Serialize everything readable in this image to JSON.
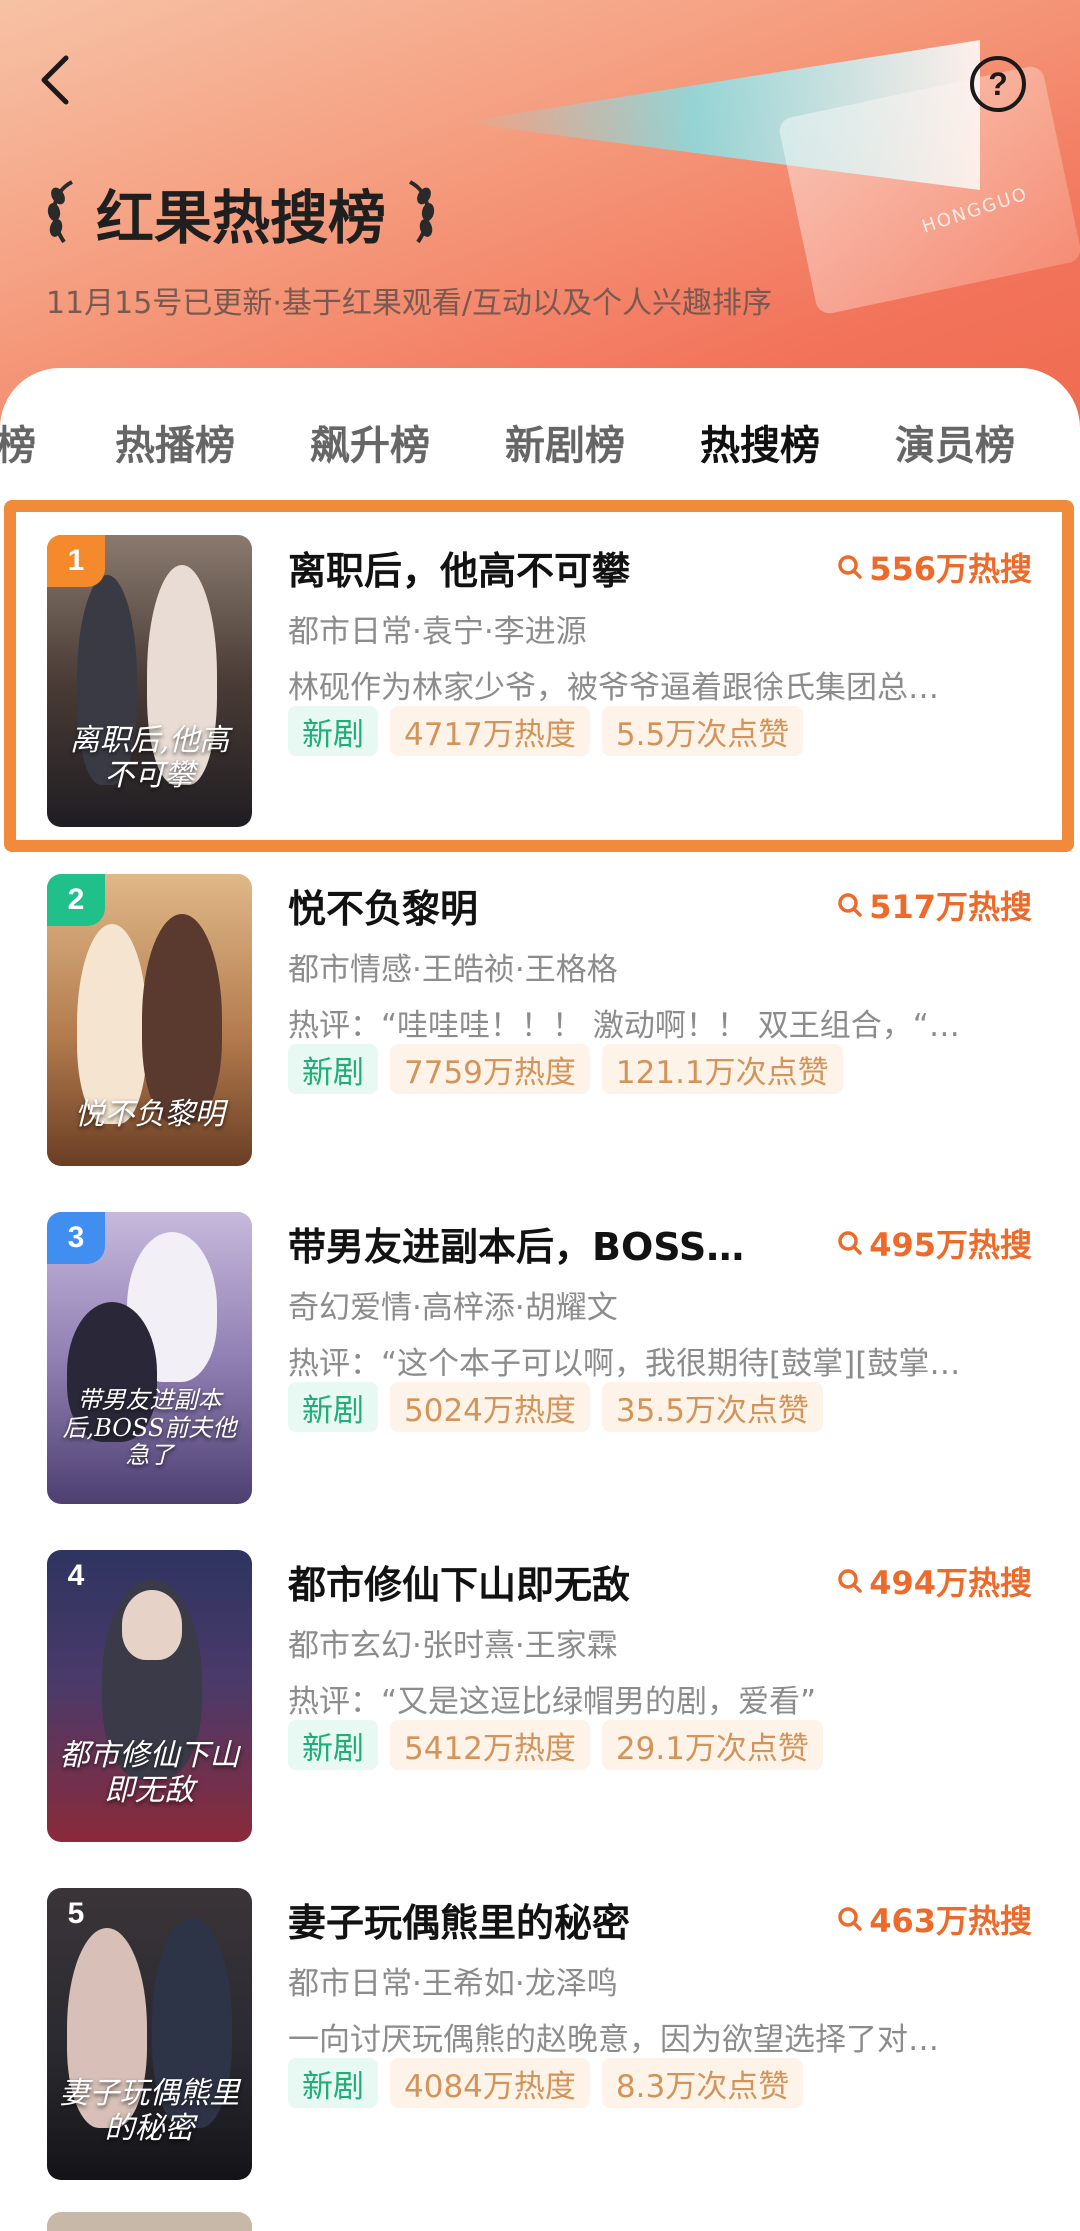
{
  "header": {
    "title": "红果热搜榜",
    "subtitle": "11月15号已更新·基于红果观看/互动以及个人兴趣排序",
    "watermark": "HONGGUO"
  },
  "tabs": [
    {
      "label": "榜",
      "active": false
    },
    {
      "label": "热播榜",
      "active": false
    },
    {
      "label": "飙升榜",
      "active": false
    },
    {
      "label": "新剧榜",
      "active": false
    },
    {
      "label": "热搜榜",
      "active": true
    },
    {
      "label": "演员榜",
      "active": false
    }
  ],
  "items": [
    {
      "rank": "1",
      "rank_color": "#f58a2c",
      "title": "离职后，他高不可攀",
      "hot": "556万热搜",
      "meta": "都市日常·袁宁·李进源",
      "desc": "林砚作为林家少爷，被爷爷逼着跟徐氏集团总…",
      "tags": [
        "新剧",
        "4717万热度",
        "5.5万次点赞"
      ],
      "poster_caption": "离职后,他高不可攀",
      "poster_colors": [
        "#6b5a52",
        "#2b2a30"
      ]
    },
    {
      "rank": "2",
      "rank_color": "#20c08a",
      "title": "悦不负黎明",
      "hot": "517万热搜",
      "meta": "都市情感·王皓祯·王格格",
      "desc": "热评：“哇哇哇！！！ 激动啊！！ 双王组合，“…",
      "tags": [
        "新剧",
        "7759万热度",
        "121.1万次点赞"
      ],
      "poster_caption": "悦不负黎明",
      "poster_colors": [
        "#d8a774",
        "#7a4a2e"
      ]
    },
    {
      "rank": "3",
      "rank_color": "#3f8ef0",
      "title": "带男友进副本后，BOSS…",
      "hot": "495万热搜",
      "meta": "奇幻爱情·高梓添·胡耀文",
      "desc": "热评：“这个本子可以啊，我很期待[鼓掌][鼓掌…",
      "tags": [
        "新剧",
        "5024万热度",
        "35.5万次点赞"
      ],
      "poster_caption": "带男友进副本后,BOSS前夫他急了",
      "poster_colors": [
        "#b7a9cf",
        "#5a4a7a"
      ]
    },
    {
      "rank": "4",
      "rank_color": "transparent",
      "title": "都市修仙下山即无敌",
      "hot": "494万热搜",
      "meta": "都市玄幻·张时熹·王家霖",
      "desc": "热评：“又是这逗比绿帽男的剧，爱看”",
      "tags": [
        "新剧",
        "5412万热度",
        "29.1万次点赞"
      ],
      "poster_caption": "都市修仙下山即无敌",
      "poster_colors": [
        "#3a3f6a",
        "#7a2a3a"
      ]
    },
    {
      "rank": "5",
      "rank_color": "transparent",
      "title": "妻子玩偶熊里的秘密",
      "hot": "463万热搜",
      "meta": "都市日常·王希如·龙泽鸣",
      "desc": "一向讨厌玩偶熊的赵晚意，因为欲望选择了对…",
      "tags": [
        "新剧",
        "4084万热度",
        "8.3万次点赞"
      ],
      "poster_caption": "妻子玩偶熊里的秘密",
      "poster_colors": [
        "#2a2a30",
        "#6a5a58"
      ]
    }
  ],
  "icons": {
    "back": "chevron-left-icon",
    "help": "question-circle-icon",
    "hot": "search-icon"
  }
}
